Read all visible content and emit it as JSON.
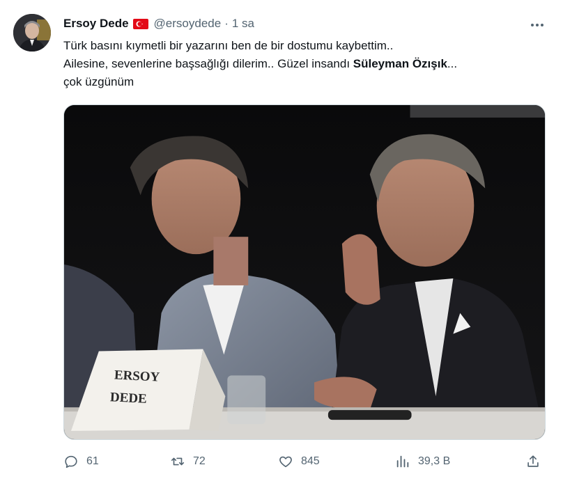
{
  "tweet": {
    "author": {
      "display_name": "Ersoy Dede",
      "flag_icon": "turkey-flag-icon",
      "handle": "@ersoydede",
      "separator": "·",
      "timestamp": "1 sa"
    },
    "text": {
      "line1": "Türk basını kıymetli bir yazarını ben de bir dostumu kaybettim..",
      "line2_prefix": "Ailesine, sevenlerine başsağlığı dilerim.. Güzel insandı ",
      "line2_bold": "Süleyman Özışık",
      "line2_suffix": "...",
      "line3": "çok üzgünüm"
    },
    "media": {
      "nameplate": {
        "line1": "ERSOY",
        "line2": "DEDE"
      }
    },
    "actions": {
      "reply": {
        "icon": "reply-icon",
        "count": "61"
      },
      "retweet": {
        "icon": "retweet-icon",
        "count": "72"
      },
      "like": {
        "icon": "heart-icon",
        "count": "845"
      },
      "views": {
        "icon": "views-icon",
        "count": "39,3 B"
      },
      "share": {
        "icon": "share-icon"
      }
    }
  },
  "colors": {
    "primary_text": "#0f1419",
    "secondary_text": "#536471",
    "border": "#cfd9de",
    "flag_red": "#e30a17"
  }
}
